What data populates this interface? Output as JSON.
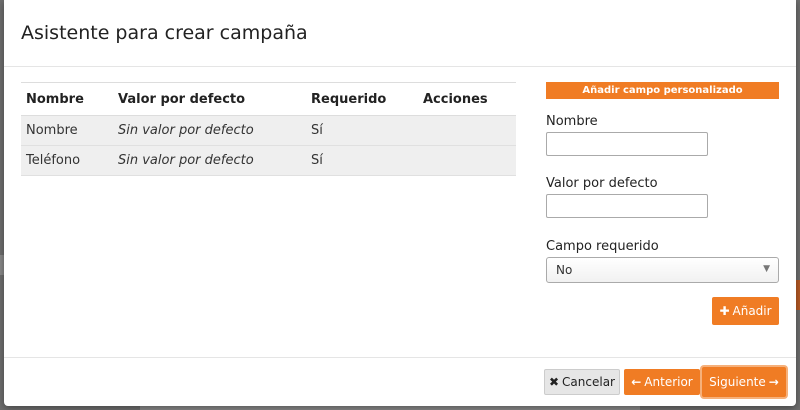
{
  "dialog": {
    "title": "Asistente para crear campaña"
  },
  "fields_table": {
    "headers": [
      "Nombre",
      "Valor por defecto",
      "Requerido",
      "Acciones"
    ],
    "rows": [
      {
        "nombre": "Nombre",
        "valor": "Sin valor por defecto",
        "requerido": "Sí",
        "acciones": ""
      },
      {
        "nombre": "Teléfono",
        "valor": "Sin valor por defecto",
        "requerido": "Sí",
        "acciones": ""
      }
    ]
  },
  "custom_field": {
    "header": "Añadir campo personalizado",
    "name_label": "Nombre",
    "name_value": "",
    "default_label": "Valor por defecto",
    "default_value": "",
    "required_label": "Campo requerido",
    "required_value": "No",
    "add_label": "Añadir",
    "add_icon": "plus-icon"
  },
  "footer": {
    "cancel_label": "Cancelar",
    "cancel_icon": "close-icon",
    "prev_label": "Anterior",
    "prev_icon": "arrow-left-icon",
    "next_label": "Siguiente",
    "next_icon": "arrow-right-icon"
  },
  "colors": {
    "accent": "#f07c24",
    "backdrop": "#6f6f6f"
  }
}
